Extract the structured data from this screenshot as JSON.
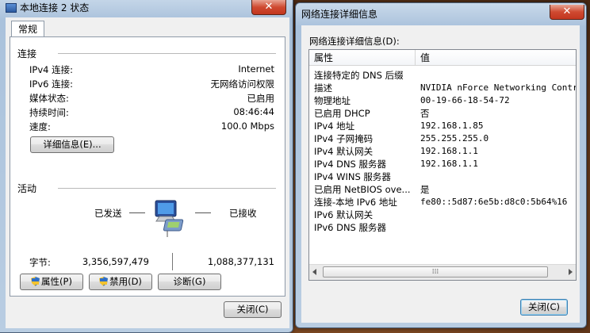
{
  "left_window": {
    "title": "本地连接 2 状态",
    "tab": "常规",
    "connection": {
      "heading": "连接",
      "rows": [
        {
          "label": "IPv4 连接:",
          "value": "Internet"
        },
        {
          "label": "IPv6 连接:",
          "value": "无网络访问权限"
        },
        {
          "label": "媒体状态:",
          "value": "已启用"
        },
        {
          "label": "持续时间:",
          "value": "08:46:44"
        },
        {
          "label": "速度:",
          "value": "100.0 Mbps"
        }
      ],
      "details_button": "详细信息(E)..."
    },
    "activity": {
      "heading": "活动",
      "sent_label": "已发送",
      "received_label": "已接收",
      "bytes_label": "字节:",
      "bytes_sent": "3,356,597,479",
      "bytes_received": "1,088,377,131"
    },
    "buttons": {
      "properties": "属性(P)",
      "disable": "禁用(D)",
      "diagnose": "诊断(G)",
      "close": "关闭(C)"
    },
    "close_glyph": "✕"
  },
  "right_window": {
    "title": "网络连接详细信息",
    "list_label": "网络连接详细信息(D):",
    "columns": [
      "属性",
      "值"
    ],
    "rows": [
      {
        "property": "连接特定的 DNS 后缀",
        "value": ""
      },
      {
        "property": "描述",
        "value": "NVIDIA nForce Networking Controll"
      },
      {
        "property": "物理地址",
        "value": "00-19-66-18-54-72"
      },
      {
        "property": "已启用 DHCP",
        "value": "否"
      },
      {
        "property": "IPv4 地址",
        "value": "192.168.1.85"
      },
      {
        "property": "IPv4 子网掩码",
        "value": "255.255.255.0"
      },
      {
        "property": "IPv4 默认网关",
        "value": "192.168.1.1"
      },
      {
        "property": "IPv4 DNS 服务器",
        "value": "192.168.1.1"
      },
      {
        "property": "IPv4 WINS 服务器",
        "value": ""
      },
      {
        "property": "已启用 NetBIOS ove...",
        "value": "是"
      },
      {
        "property": "连接-本地 IPv6 地址",
        "value": "fe80::5d87:6e5b:d8c0:5b64%16"
      },
      {
        "property": "IPv6 默认网关",
        "value": ""
      },
      {
        "property": "IPv6 DNS 服务器",
        "value": ""
      }
    ],
    "scroll_grip": "⁞⁞⁞",
    "close_button": "关闭(C)",
    "close_glyph": "✕"
  },
  "colors": {
    "desktop": "#6b3c1c",
    "title_bar": "#b9cde2",
    "close_red": "#cf4a31",
    "focus_blue": "#3c7fb1"
  }
}
